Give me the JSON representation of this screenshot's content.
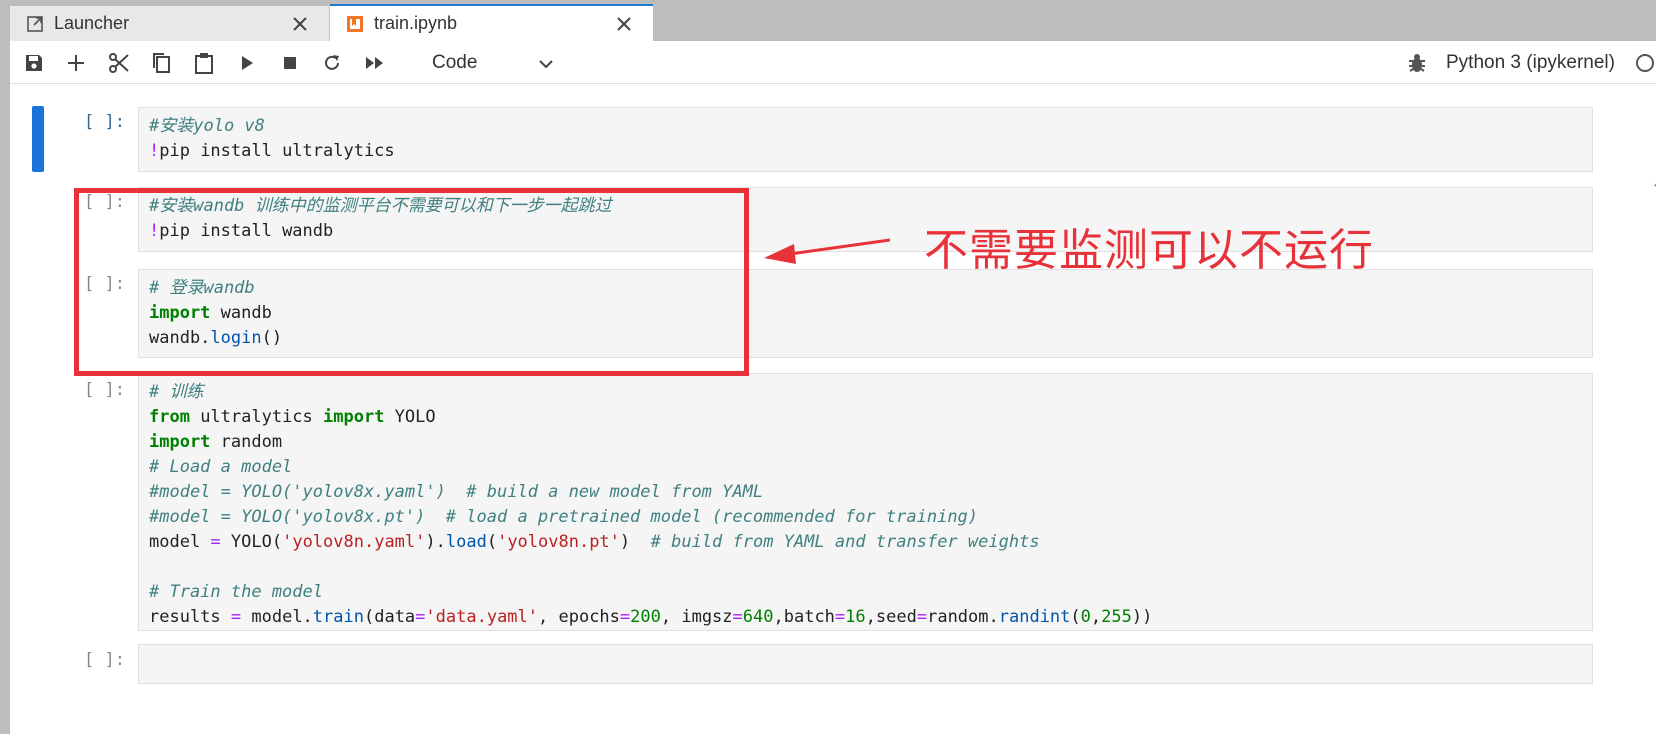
{
  "tabs": [
    {
      "label": "Launcher",
      "icon": "launch-icon",
      "active": false
    },
    {
      "label": "train.ipynb",
      "icon": "notebook-icon",
      "active": true
    }
  ],
  "toolbar": {
    "buttons": [
      "save-icon",
      "add-cell-icon",
      "cut-icon",
      "copy-icon",
      "paste-icon",
      "run-icon",
      "stop-icon",
      "restart-icon",
      "fast-forward-icon"
    ],
    "cell_type": "Code",
    "kernel": "Python 3 (ipykernel)",
    "accent_color": "#1a73d9"
  },
  "cells": [
    {
      "prompt": "[ ]:",
      "lines": [
        "#安装yolo v8",
        "!pip install ultralytics"
      ]
    },
    {
      "prompt": "[ ]:",
      "lines": [
        "#安装wandb 训练中的监测平台不需要可以和下一步一起跳过",
        "!pip install wandb"
      ]
    },
    {
      "prompt": "[ ]:",
      "lines": [
        "# 登录wandb",
        "import wandb",
        "wandb.login()"
      ]
    },
    {
      "prompt": "[ ]:",
      "lines": [
        "# 训练",
        "from ultralytics import YOLO",
        "import random",
        "# Load a model",
        "#model = YOLO('yolov8x.yaml')  # build a new model from YAML",
        "#model = YOLO('yolov8x.pt')  # load a pretrained model (recommended for training)",
        "model = YOLO('yolov8n.yaml').load('yolov8n.pt')  # build from YAML and transfer weights",
        "",
        "# Train the model",
        "results = model.train(data='data.yaml', epochs=200, imgsz=640,batch=16,seed=random.randint(0,255))"
      ]
    },
    {
      "prompt": "[ ]:",
      "lines": [
        ""
      ]
    }
  ],
  "annotation": {
    "text": "不需要监测可以不运行",
    "color": "#e8323a"
  }
}
